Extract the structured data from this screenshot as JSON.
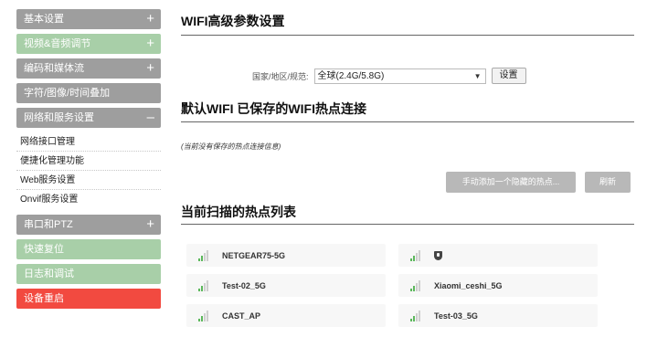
{
  "sidebar": {
    "items": [
      {
        "label": "基本设置",
        "sign": "+"
      },
      {
        "label": "视频&音频调节",
        "sign": "+"
      },
      {
        "label": "编码和媒体流",
        "sign": "+"
      },
      {
        "label": "字符/图像/时间叠加",
        "sign": ""
      },
      {
        "label": "网络和服务设置",
        "sign": "–"
      },
      {
        "label": "串口和PTZ",
        "sign": "+"
      },
      {
        "label": "快速复位",
        "sign": ""
      },
      {
        "label": "日志和调试",
        "sign": ""
      },
      {
        "label": "设备重启",
        "sign": ""
      }
    ],
    "subitems": [
      "网络接口管理",
      "便捷化管理功能",
      "Web服务设置",
      "Onvif服务设置"
    ]
  },
  "main": {
    "wifi_title": "WIFI高级参数设置",
    "country_label": "国家/地区/规范:",
    "country_value": "全球(2.4G/5.8G)",
    "set_button": "设置",
    "saved_title": "默认WIFI 已保存的WIFI热点连接",
    "saved_note": "(当前没有保存的热点连接信息)",
    "add_hidden_button": "手动添加一个隐藏的热点...",
    "refresh_button": "刷新",
    "scan_title": "当前扫描的热点列表",
    "hotspots": [
      "NETGEAR75-5G",
      "",
      "Test-02_5G",
      "Xiaomi_ceshi_5G",
      "CAST_AP",
      "Test-03_5G"
    ]
  },
  "icons": {
    "plus": "plus-icon",
    "minus": "minus-icon",
    "dropdown": "chevron-down-icon",
    "signal": "wifi-signal-icon",
    "shield": "shield-icon"
  },
  "colors": {
    "menu_gray": "#9e9e9e",
    "menu_green": "#a8cfa8",
    "menu_red": "#f24a40",
    "signal_green": "#5cb85c"
  }
}
